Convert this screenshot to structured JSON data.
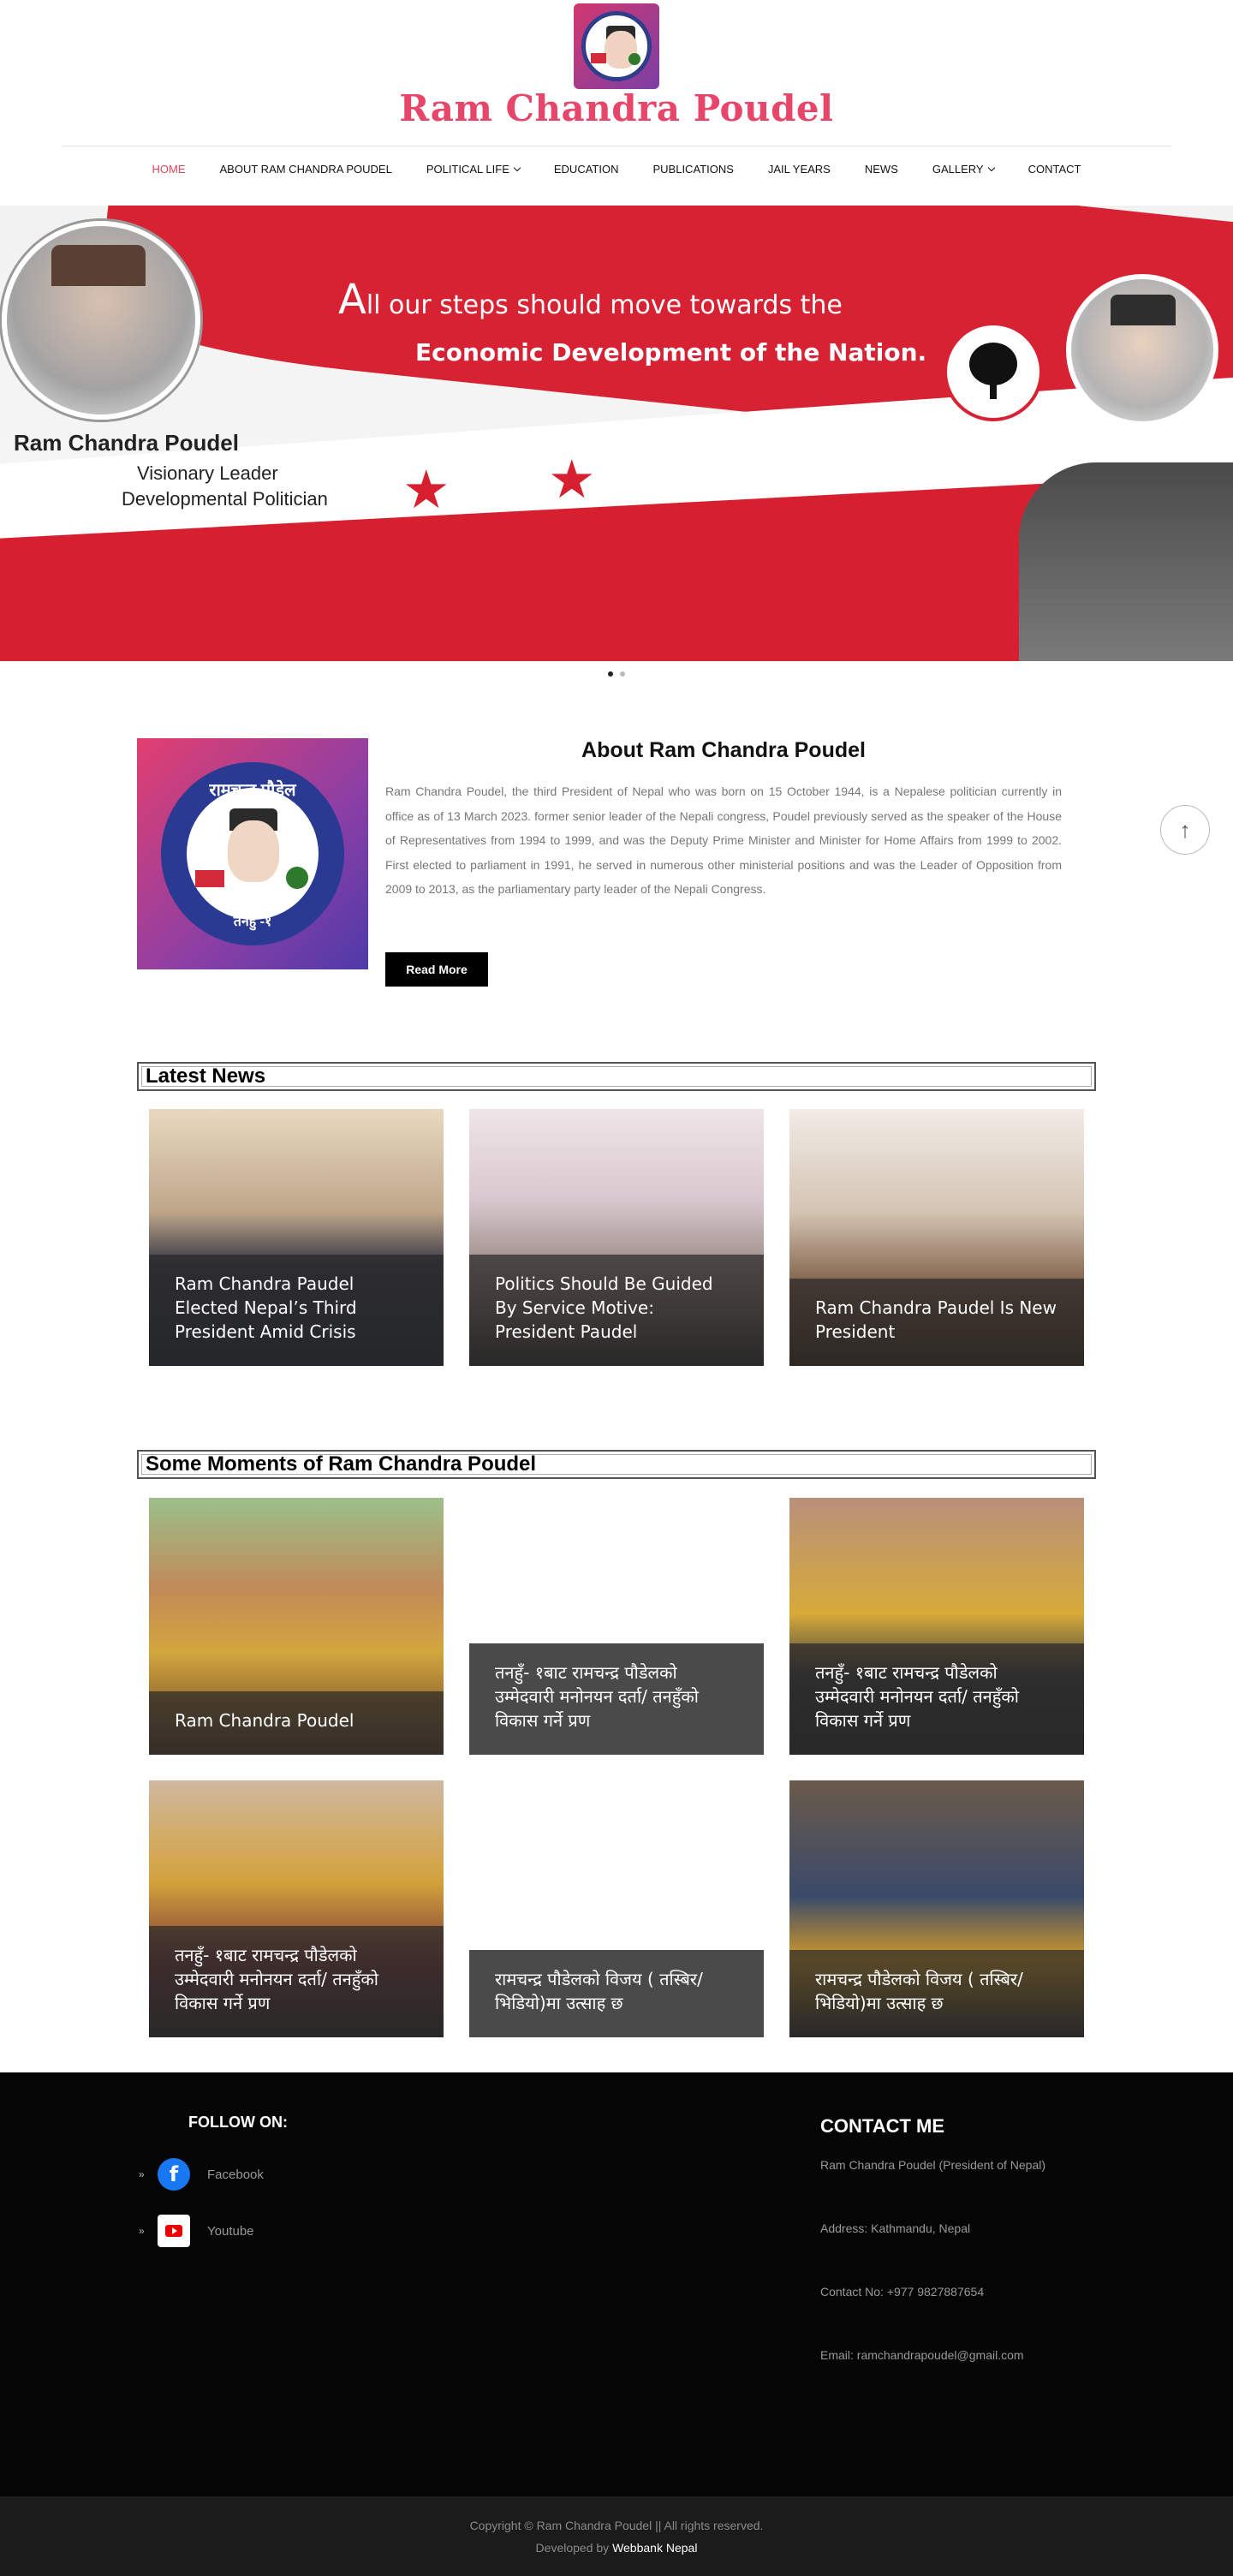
{
  "header": {
    "site_title": "Ram Chandra Poudel",
    "nav": [
      {
        "label": "HOME",
        "active": true,
        "dropdown": false
      },
      {
        "label": "ABOUT RAM CHANDRA POUDEL",
        "active": false,
        "dropdown": false
      },
      {
        "label": "POLITICAL LIFE",
        "active": false,
        "dropdown": true
      },
      {
        "label": "EDUCATION",
        "active": false,
        "dropdown": false
      },
      {
        "label": "PUBLICATIONS",
        "active": false,
        "dropdown": false
      },
      {
        "label": "JAIL YEARS",
        "active": false,
        "dropdown": false
      },
      {
        "label": "NEWS",
        "active": false,
        "dropdown": false
      },
      {
        "label": "GALLERY",
        "active": false,
        "dropdown": true
      },
      {
        "label": "CONTACT",
        "active": false,
        "dropdown": false
      }
    ]
  },
  "hero": {
    "line1_first": "A",
    "line1_rest": "ll our steps should move towards the",
    "line2": "Economic Development of the Nation.",
    "name": "Ram Chandra Poudel",
    "sub1": "Visionary Leader",
    "sub2": "Developmental Politician",
    "slides": 2,
    "active_slide": 1
  },
  "about": {
    "logo_top": "रामचन्द्र पौडेल",
    "logo_bottom": "तनहुँ -१",
    "title": "About Ram Chandra Poudel",
    "text": "Ram Chandra Poudel, the third President of Nepal who was born on 15 October 1944, is a Nepalese politician currently in office as of 13 March 2023.  former senior leader of the Nepali congress, Poudel previously served as the speaker of the House of Representatives from 1994 to 1999, and was the Deputy Prime Minister and Minister for Home Affairs from 1999 to 2002. First elected to parliament in 1991, he served in numerous other ministerial positions and was the Leader of Opposition from 2009 to 2013, as the parliamentary party leader of the Nepali Congress.",
    "read_more": "Read More"
  },
  "news": {
    "title": "Latest News",
    "items": [
      {
        "caption": "Ram Chandra Paudel Elected Nepal’s Third President Amid Crisis"
      },
      {
        "caption": "Politics Should Be Guided By Service Motive: President Paudel"
      },
      {
        "caption": "Ram Chandra Paudel Is New President"
      }
    ]
  },
  "moments": {
    "title": "Some Moments of Ram Chandra Poudel",
    "items": [
      {
        "caption": "Ram Chandra Poudel"
      },
      {
        "caption": "तनहुँ- १बाट रामचन्द्र पौडेलको उम्मेदवारी मनोनयन दर्ता/ तनहुँको विकास गर्ने प्रण"
      },
      {
        "caption": "तनहुँ- १बाट रामचन्द्र पौडेलको उम्मेदवारी मनोनयन दर्ता/ तनहुँको विकास गर्ने प्रण"
      },
      {
        "caption": "तनहुँ- १बाट रामचन्द्र पौडेलको उम्मेदवारी मनोनयन दर्ता/ तनहुँको विकास गर्ने प्रण"
      },
      {
        "caption": "रामचन्द्र पौडेलको विजय ( तस्बिर/ भिडियो)मा उत्साह छ"
      },
      {
        "caption": "रामचन्द्र पौडेलको विजय ( तस्बिर/ भिडियो)मा उत्साह छ"
      }
    ]
  },
  "footer": {
    "follow_title": "FOLLOW ON:",
    "facebook": "Facebook",
    "youtube": "Youtube",
    "contact_title": "CONTACT ME",
    "contact_name": "Ram Chandra Poudel (President of Nepal)",
    "address": "Address: Kathmandu, Nepal",
    "phone": "Contact No: +977 9827887654",
    "email": "Email: ramchandrapoudel@gmail.com",
    "copyright": "Copyright © Ram Chandra Poudel || All rights reserved.",
    "developed_by_prefix": "Developed by ",
    "developer": "Webbank Nepal"
  },
  "scroll_top_icon": "arrow-up-icon",
  "accent_color": "#e0445c"
}
